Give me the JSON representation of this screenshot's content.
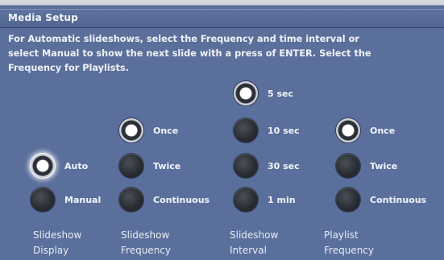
{
  "window": {
    "title": "Media Setup"
  },
  "instructions": [
    "For Automatic slideshows, select the Frequency and time interval or",
    "select Manual to show the next slide with a press of ENTER. Select the",
    "Frequency for Playlists."
  ],
  "slideshow_display": {
    "label_line1": "Slideshow",
    "label_line2": "Display",
    "options": [
      {
        "label": "Auto",
        "selected": true
      },
      {
        "label": "Manual",
        "selected": false
      }
    ]
  },
  "slideshow_frequency": {
    "label_line1": "Slideshow",
    "label_line2": "Frequency",
    "options": [
      {
        "label": "Once",
        "selected": true
      },
      {
        "label": "Twice",
        "selected": false
      },
      {
        "label": "Continuous",
        "selected": false
      }
    ]
  },
  "slideshow_interval": {
    "label_line1": "Slideshow",
    "label_line2": "Interval",
    "options": [
      {
        "label": "5 sec",
        "selected": true
      },
      {
        "label": "10 sec",
        "selected": false
      },
      {
        "label": "30 sec",
        "selected": false
      },
      {
        "label": "1 min",
        "selected": false
      }
    ]
  },
  "playlist_frequency": {
    "label_line1": "Playlist",
    "label_line2": "Frequency",
    "options": [
      {
        "label": "Once",
        "selected": true
      },
      {
        "label": "Twice",
        "selected": false
      },
      {
        "label": "Continuous",
        "selected": false
      }
    ]
  }
}
